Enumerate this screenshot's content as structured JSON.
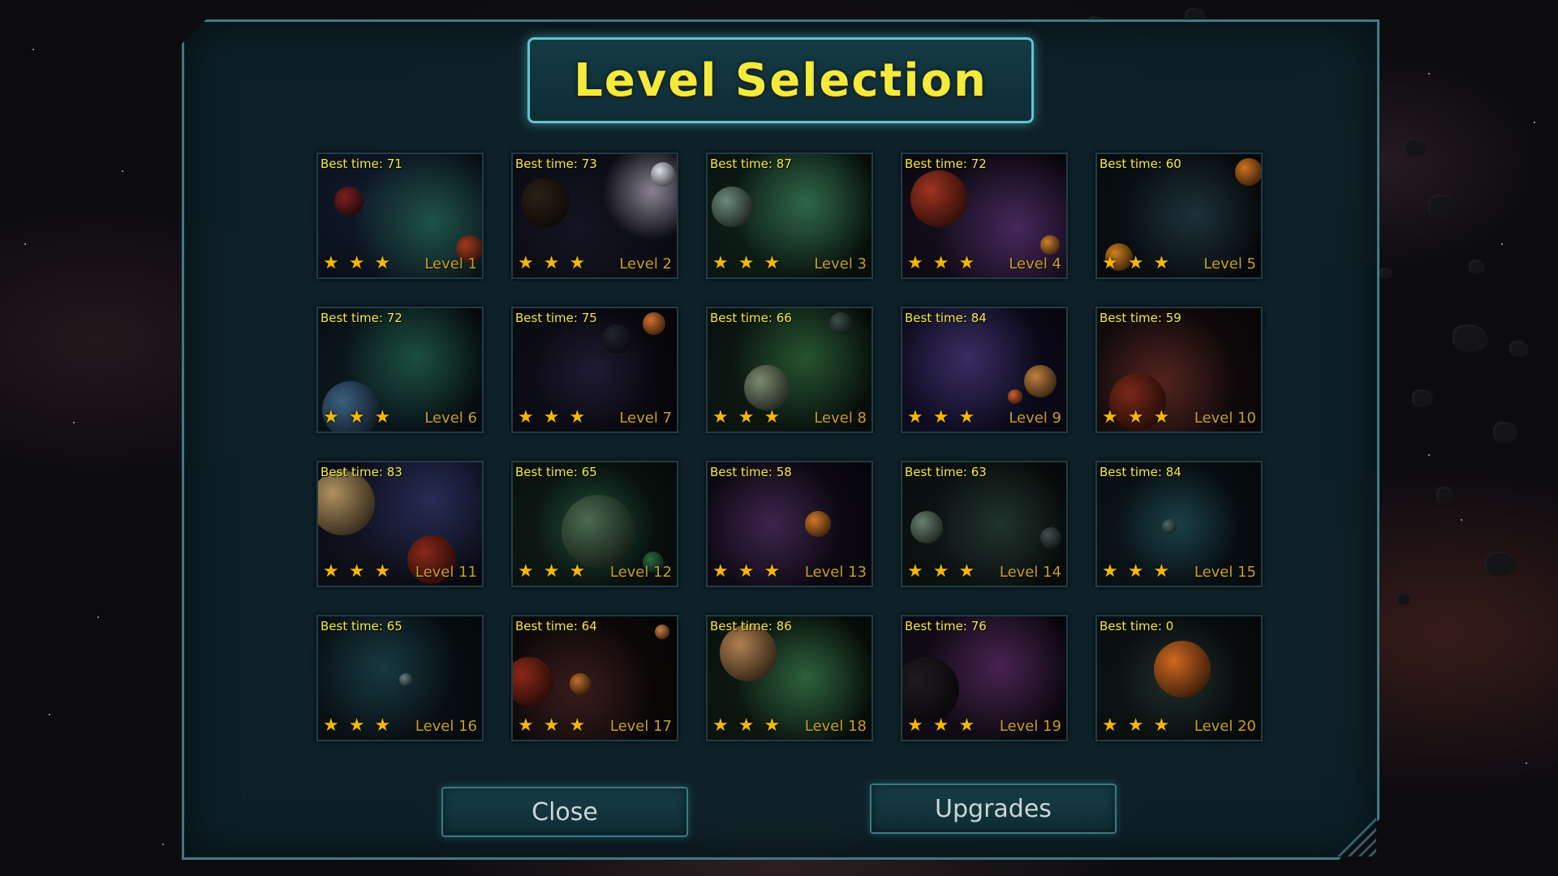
{
  "title": "Level Selection",
  "buttons": {
    "close_label": "Close",
    "upgrades_label": "Upgrades"
  },
  "colors": {
    "title": "#f4ea3c",
    "best_time": "#f4ea3c",
    "star": "#f5b800",
    "level_label": "#c8a020",
    "panel_border": "#3c7c86"
  },
  "levels": [
    {
      "best": "Best time: 71",
      "label": "Level 1",
      "stars": 3
    },
    {
      "best": "Best time: 73",
      "label": "Level 2",
      "stars": 3
    },
    {
      "best": "Best time: 87",
      "label": "Level 3",
      "stars": 3
    },
    {
      "best": "Best time: 72",
      "label": "Level 4",
      "stars": 3
    },
    {
      "best": "Best time: 60",
      "label": "Level 5",
      "stars": 3
    },
    {
      "best": "Best time: 72",
      "label": "Level 6",
      "stars": 3
    },
    {
      "best": "Best time: 75",
      "label": "Level 7",
      "stars": 3
    },
    {
      "best": "Best time: 66",
      "label": "Level 8",
      "stars": 3
    },
    {
      "best": "Best time: 84",
      "label": "Level 9",
      "stars": 3
    },
    {
      "best": "Best time: 59",
      "label": "Level 10",
      "stars": 3
    },
    {
      "best": "Best time: 83",
      "label": "Level 11",
      "stars": 3
    },
    {
      "best": "Best time: 65",
      "label": "Level 12",
      "stars": 3
    },
    {
      "best": "Best time: 58",
      "label": "Level 13",
      "stars": 3
    },
    {
      "best": "Best time: 63",
      "label": "Level 14",
      "stars": 3
    },
    {
      "best": "Best time: 84",
      "label": "Level 15",
      "stars": 3
    },
    {
      "best": "Best time: 65",
      "label": "Level 16",
      "stars": 3
    },
    {
      "best": "Best time: 64",
      "label": "Level 17",
      "stars": 3
    },
    {
      "best": "Best time: 86",
      "label": "Level 18",
      "stars": 3
    },
    {
      "best": "Best time: 76",
      "label": "Level 19",
      "stars": 3
    },
    {
      "best": "Best time: 0",
      "label": "Level 20",
      "stars": 3
    }
  ]
}
